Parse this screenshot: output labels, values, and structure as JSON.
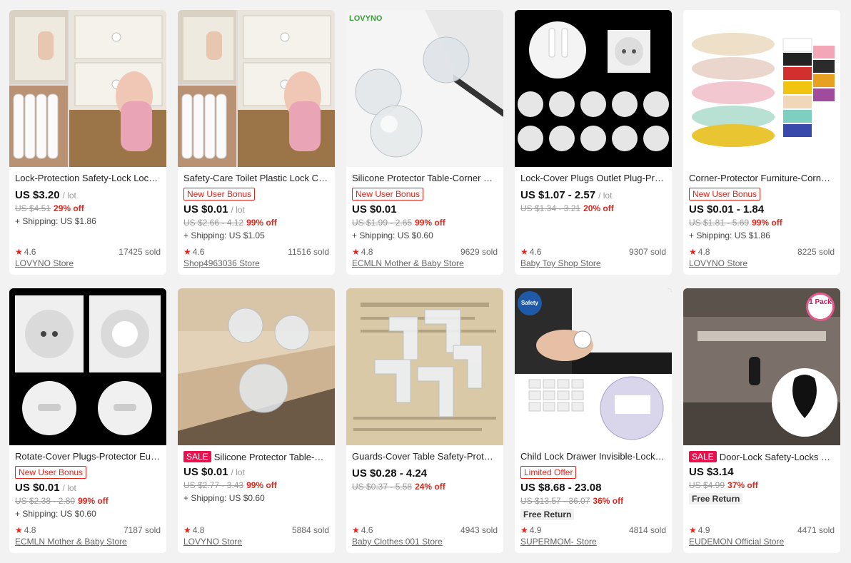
{
  "products": [
    {
      "title": "Lock-Protection Safety-Lock Locking Cabinet",
      "badge": "",
      "sale": "",
      "price": "US $3.20",
      "unit": "/ lot",
      "orig": "US $4.51",
      "disc": "29% off",
      "shipping": "+ Shipping: US $1.86",
      "free": "",
      "rating": "4.6",
      "sold": "17425 sold",
      "store": "LOVYNO Store",
      "image": "baby-cabinet-locks-photo"
    },
    {
      "title": "Safety-Care Toilet Plastic Lock Cupboard",
      "badge": "New User Bonus",
      "sale": "",
      "price": "US $0.01",
      "unit": "/ lot",
      "orig": "US $2.66 - 4.12",
      "disc": "99% off",
      "shipping": "+ Shipping: US $1.05",
      "free": "",
      "rating": "4.6",
      "sold": "11516 sold",
      "store": "Shop4963036 Store",
      "image": "baby-cabinet-locks-photo"
    },
    {
      "title": "Silicone Protector Table-Corner Baby",
      "badge": "New User Bonus",
      "sale": "",
      "price": "US $0.01",
      "unit": "",
      "orig": "US $1.99 - 2.65",
      "disc": "99% off",
      "shipping": "+ Shipping: US $0.60",
      "free": "",
      "rating": "4.8",
      "sold": "9629 sold",
      "store": "ECMLN Mother & Baby Store",
      "image": "corner-guards-photo",
      "brand": "LOVYNO"
    },
    {
      "title": "Lock-Cover Plugs Outlet Plug-Protector",
      "badge": "",
      "sale": "",
      "price": "US $1.07 - 2.57",
      "unit": "/ lot",
      "orig": "US $1.34 - 3.21",
      "disc": "20% off",
      "shipping": "",
      "free": "",
      "rating": "4.6",
      "sold": "9307 sold",
      "store": "Baby Toy Shop Store",
      "image": "outlet-covers-photo"
    },
    {
      "title": "Corner-Protector Furniture-Corner-Edge",
      "badge": "New User Bonus",
      "sale": "",
      "price": "US $0.01 - 1.84",
      "unit": "",
      "orig": "US $1.81 - 5.69",
      "disc": "99% off",
      "shipping": "+ Shipping: US $1.86",
      "free": "",
      "rating": "4.8",
      "sold": "8225 sold",
      "store": "LOVYNO Store",
      "image": "foam-edge-rolls-photo"
    },
    {
      "title": "Rotate-Cover Plugs-Protector Eu-Power",
      "badge": "New User Bonus",
      "sale": "",
      "price": "US $0.01",
      "unit": "/ lot",
      "orig": "US $2.38 - 2.80",
      "disc": "99% off",
      "shipping": "+ Shipping: US $0.60",
      "free": "",
      "rating": "4.8",
      "sold": "7187 sold",
      "store": "ECMLN Mother & Baby Store",
      "image": "eu-socket-covers-photo"
    },
    {
      "title": "Silicone Protector Table-Corner",
      "badge": "",
      "sale": "SALE",
      "price": "US $0.01",
      "unit": "/ lot",
      "orig": "US $2.77 - 3.43",
      "disc": "99% off",
      "shipping": "+ Shipping: US $0.60",
      "free": "",
      "rating": "4.8",
      "sold": "5884 sold",
      "store": "LOVYNO Store",
      "image": "clear-corner-guards-photo"
    },
    {
      "title": "Guards-Cover Table Safety-Protector",
      "badge": "",
      "sale": "",
      "price": "US $0.28 - 4.24",
      "unit": "",
      "orig": "US $0.37 - 5.58",
      "disc": "24% off",
      "shipping": "",
      "free": "",
      "rating": "4.6",
      "sold": "4943 sold",
      "store": "Baby Clothes 001 Store",
      "image": "l-corner-guards-photo"
    },
    {
      "title": "Child Lock Drawer Invisible-Lock Baby",
      "badge": "Limited Offer",
      "sale": "",
      "price": "US $8.68 - 23.08",
      "unit": "",
      "orig": "US $13.57 - 36.07",
      "disc": "36% off",
      "shipping": "",
      "free": "Free Return",
      "rating": "4.9",
      "sold": "4814 sold",
      "store": "SUPERMOM- Store",
      "image": "magnetic-lock-photo",
      "brand": "Safety"
    },
    {
      "title": "Door-Lock Safety-Locks Drawer",
      "badge": "",
      "sale": "SALE",
      "price": "US $3.14",
      "unit": "",
      "orig": "US $4.99",
      "disc": "37% off",
      "shipping": "",
      "free": "Free Return",
      "rating": "4.9",
      "sold": "4471 sold",
      "store": "EUDEMON Official Store",
      "image": "oven-lock-photo",
      "brand": "1 Pack"
    }
  ],
  "colors": {
    "accent": "#e1251b",
    "sale": "#e8124f",
    "background": "#f2f2f2"
  }
}
